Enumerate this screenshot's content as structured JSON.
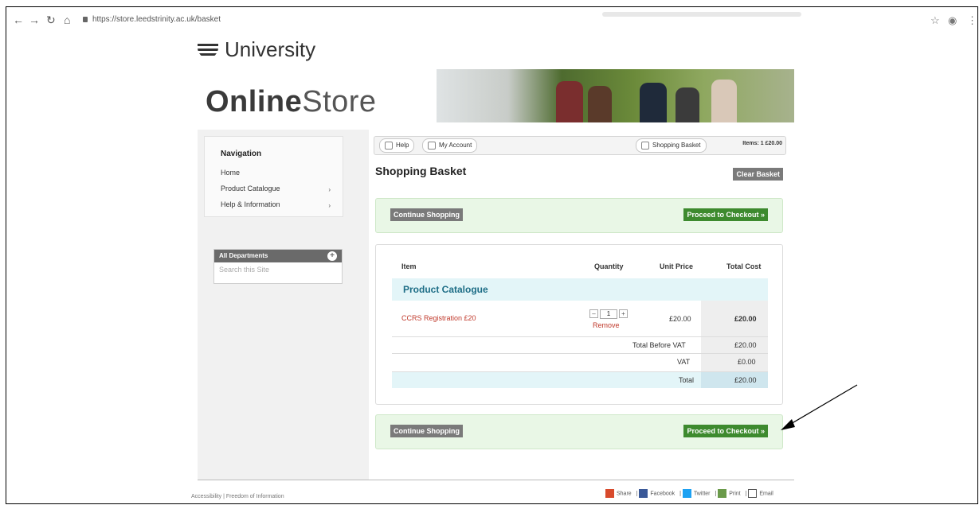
{
  "browser": {
    "url": "https://store.leedstrinity.ac.uk/basket",
    "back_icon": "arrow-left-icon",
    "forward_icon": "arrow-right-icon",
    "reload_icon": "reload-icon",
    "home_icon": "home-icon"
  },
  "site": {
    "university_label": "University",
    "store_title_bold": "Online",
    "store_title_light": "Store"
  },
  "sidebar": {
    "heading": "Navigation",
    "items": [
      {
        "label": "Home"
      },
      {
        "label": "Product Catalogue",
        "arrow": "›"
      },
      {
        "label": "Help & Information",
        "arrow": "›"
      }
    ],
    "departments": {
      "label": "All Departments",
      "search_placeholder": "Search this Site"
    }
  },
  "utility": {
    "help": "Help",
    "account": "My Account",
    "basket": "Shopping Basket",
    "items": "Items: 1 £20.00"
  },
  "main": {
    "title": "Shopping Basket",
    "clear_button": "Clear Basket",
    "continue_button": "Continue Shopping",
    "checkout_button": "Proceed to Checkout »"
  },
  "basket": {
    "headers": {
      "item": "Item",
      "quantity": "Quantity",
      "unit_price": "Unit Price",
      "total_cost": "Total Cost"
    },
    "category": "Product Catalogue",
    "line_item": {
      "name": "CCRS Registration £20",
      "quantity": "1",
      "remove": "Remove",
      "unit_price": "£20.00",
      "total": "£20.00"
    },
    "summary": {
      "before_vat_label": "Total Before VAT",
      "before_vat_value": "£20.00",
      "vat_label": "VAT",
      "vat_value": "£0.00",
      "total_label": "Total",
      "total_value": "£20.00"
    }
  },
  "footer": {
    "left": "Accessibility  |  Freedom of Information",
    "share": "Share",
    "facebook": "Facebook",
    "twitter": "Twitter",
    "print": "Print",
    "email": "Email"
  },
  "colors": {
    "accent_green": "#3d8a2e",
    "remove_red": "#c0392b",
    "category_teal": "#1d6d86"
  }
}
